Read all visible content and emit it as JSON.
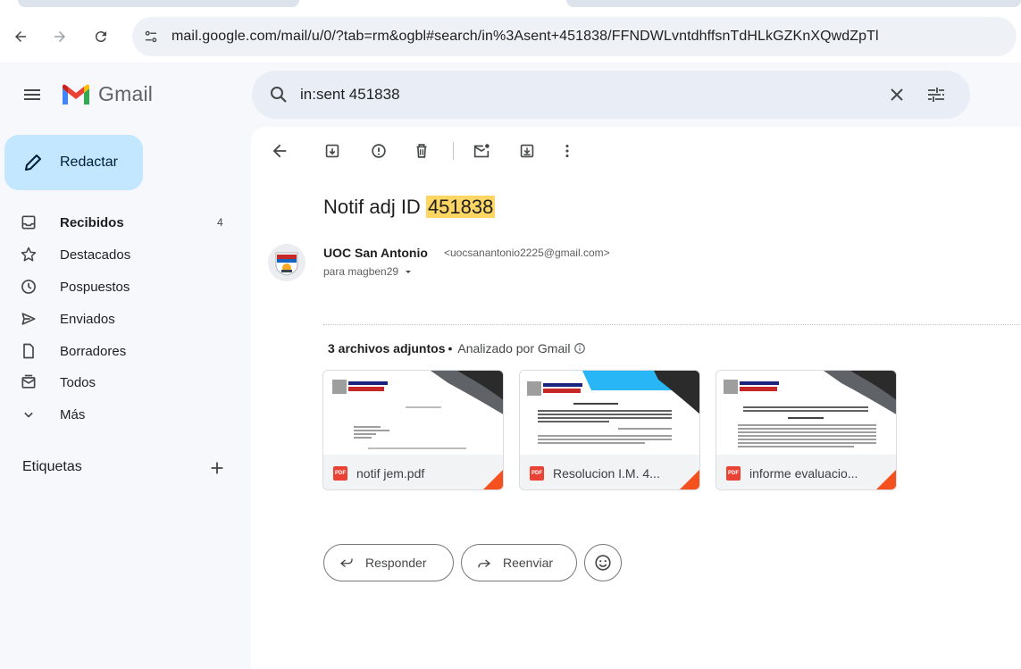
{
  "browser": {
    "url": "mail.google.com/mail/u/0/?tab=rm&ogbl#search/in%3Asent+451838/FFNDWLvntdhffsnTdHLkGZKnXQwdZpTl"
  },
  "app": {
    "name": "Gmail"
  },
  "search": {
    "query": "in:sent 451838"
  },
  "sidebar": {
    "compose_label": "Redactar",
    "items": [
      {
        "label": "Recibidos",
        "count": "4",
        "icon": "inbox-icon"
      },
      {
        "label": "Destacados",
        "count": "",
        "icon": "star-icon"
      },
      {
        "label": "Pospuestos",
        "count": "",
        "icon": "clock-icon"
      },
      {
        "label": "Enviados",
        "count": "",
        "icon": "send-icon"
      },
      {
        "label": "Borradores",
        "count": "",
        "icon": "draft-icon"
      },
      {
        "label": "Todos",
        "count": "",
        "icon": "all-mail-icon"
      },
      {
        "label": "Más",
        "count": "",
        "icon": "chevron-down-icon"
      }
    ],
    "labels_title": "Etiquetas"
  },
  "message": {
    "subject_prefix": "Notif adj ID ",
    "subject_highlight": "451838",
    "sender_name": "UOC San Antonio",
    "sender_email": "<uocsanantonio2225@gmail.com>",
    "recipient": "para magben29"
  },
  "attachments": {
    "count_label": "3 archivos adjuntos",
    "separator": "•",
    "scan_label": "Analizado por Gmail",
    "files": [
      {
        "name": "notif jem.pdf",
        "badge": "PDF"
      },
      {
        "name": "Resolucion I.M. 4...",
        "badge": "PDF"
      },
      {
        "name": "informe evaluacio...",
        "badge": "PDF"
      }
    ]
  },
  "actions": {
    "reply_label": "Responder",
    "forward_label": "Reenviar"
  },
  "colors": {
    "compose_bg": "#c2e7ff",
    "highlight": "#fdd663",
    "pdf_red": "#ea4335",
    "search_bg": "#e9eef6"
  }
}
